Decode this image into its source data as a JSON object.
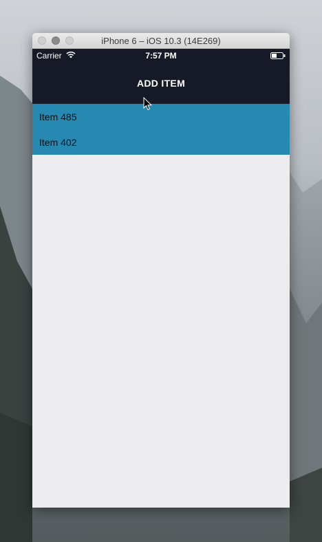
{
  "window": {
    "title": "iPhone 6 – iOS 10.3 (14E269)"
  },
  "status_bar": {
    "carrier": "Carrier",
    "time": "7:57 PM"
  },
  "nav": {
    "add_item_label": "ADD ITEM"
  },
  "list": {
    "items": [
      {
        "label": "Item 485"
      },
      {
        "label": "Item 402"
      }
    ]
  },
  "colors": {
    "nav_background": "#161a27",
    "list_background": "#2589b1",
    "content_background": "#ecebee"
  }
}
